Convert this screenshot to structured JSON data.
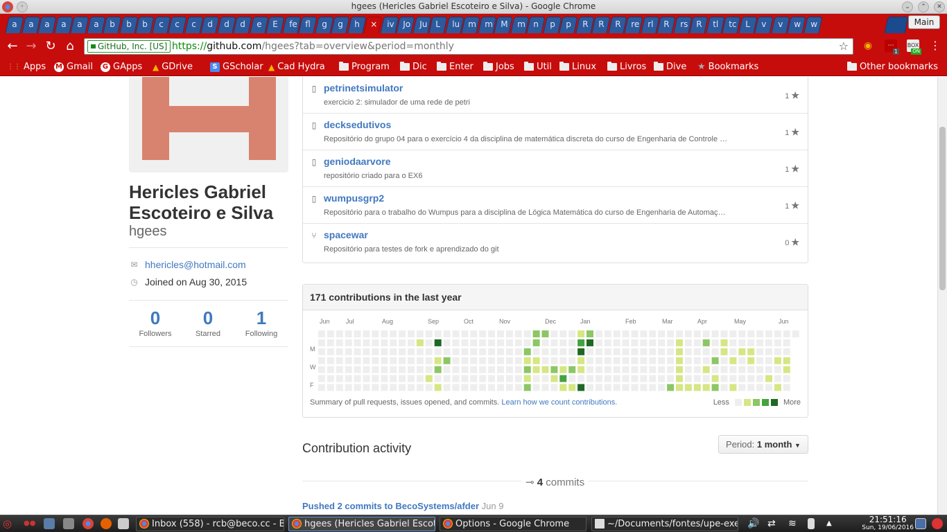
{
  "window": {
    "title": "hgees (Hericles Gabriel Escoteiro e Silva) - Google Chrome"
  },
  "tabs": {
    "letters": [
      "a",
      "a",
      "a",
      "a",
      "a",
      "a",
      "b",
      "b",
      "b",
      "c",
      "c",
      "c",
      "d",
      "d",
      "d",
      "e",
      "E",
      "fe",
      "fl",
      "g",
      "g",
      "h",
      "×",
      "iv",
      "Jo",
      "Ju",
      "L",
      "lu",
      "m",
      "m",
      "M",
      "m",
      "n",
      "p",
      "p",
      "R",
      "R",
      "R",
      "re",
      "rl",
      "R",
      "rs",
      "R",
      "tl",
      "tc",
      "L",
      "v",
      "v",
      "w",
      "w"
    ],
    "main_label": "Main"
  },
  "toolbar": {
    "secure_label": "GitHub, Inc. [US]",
    "url_scheme": "https://",
    "url_host": "github.com",
    "url_path": "/hgees?tab=overview&period=monthly",
    "ext_badge_1": "1",
    "ext_badge_2": "ON"
  },
  "bookmarks": [
    "Apps",
    "Gmail",
    "GApps",
    "GDrive",
    "GScholar",
    "Cad Hydra",
    "Program",
    "Dic",
    "Enter",
    "Jobs",
    "Util",
    "Linux",
    "Livros",
    "Dive",
    "Bookmarks"
  ],
  "other_bookmarks": "Other bookmarks",
  "profile": {
    "fullname": "Hericles Gabriel Escoteiro e Silva",
    "login": "hgees",
    "email": "hhericles@hotmail.com",
    "joined": "Joined on Aug 30, 2015",
    "followers": {
      "count": "0",
      "label": "Followers"
    },
    "starred": {
      "count": "0",
      "label": "Starred"
    },
    "following": {
      "count": "1",
      "label": "Following"
    }
  },
  "repos": [
    {
      "name": "petrinetsimulator",
      "desc": "exercicio 2: simulador de uma rede de petri",
      "stars": "1",
      "icon": "repo-icon"
    },
    {
      "name": "decksedutivos",
      "desc": "Repositório do grupo 04 para o exercício 4 da disciplina de matemática discreta do curso de Engenharia de Controle …",
      "stars": "1",
      "icon": "repo-icon"
    },
    {
      "name": "geniodaarvore",
      "desc": "repositório criado para o EX6",
      "stars": "1",
      "icon": "repo-icon"
    },
    {
      "name": "wumpusgrp2",
      "desc": "Repositório para o trabalho do Wumpus para a disciplina de Lógica Matemática do curso de Engenharia de Automaç…",
      "stars": "1",
      "icon": "repo-icon"
    },
    {
      "name": "spacewar",
      "desc": "Repositório para testes de fork e aprendizado do git",
      "stars": "0",
      "icon": "fork-icon"
    }
  ],
  "contributions": {
    "title": "171 contributions in the last year",
    "months": [
      "Jun",
      "Jul",
      "Aug",
      "Sep",
      "Oct",
      "Nov",
      "Dec",
      "Jan",
      "Feb",
      "Mar",
      "Apr",
      "May",
      "Jun"
    ],
    "days": [
      "M",
      "W",
      "F"
    ],
    "summary": "Summary of pull requests, issues opened, and commits.",
    "learn_link": "Learn how we count contributions.",
    "less": "Less",
    "more": "More",
    "colors": [
      "#eeeeee",
      "#d6e685",
      "#8cc665",
      "#44a340",
      "#1e6823"
    ]
  },
  "activity": {
    "title": "Contribution activity",
    "period_label": "Period:",
    "period_value": "1 month",
    "commits_count": "4",
    "commits_label": "commits",
    "pushed": "Pushed 2 commits to BecoSystems/afder",
    "pushed_date": "Jun 9"
  },
  "taskbar": {
    "windows": [
      {
        "label": "Inbox (558) - rcb@beco.cc - B"
      },
      {
        "label": "hgees (Hericles Gabriel Escot"
      },
      {
        "label": "Options - Google Chrome"
      },
      {
        "label": "~/Documents/fontes/upe-exe"
      }
    ],
    "time": "21:51:16",
    "date": "Sun, 19/06/2016"
  }
}
